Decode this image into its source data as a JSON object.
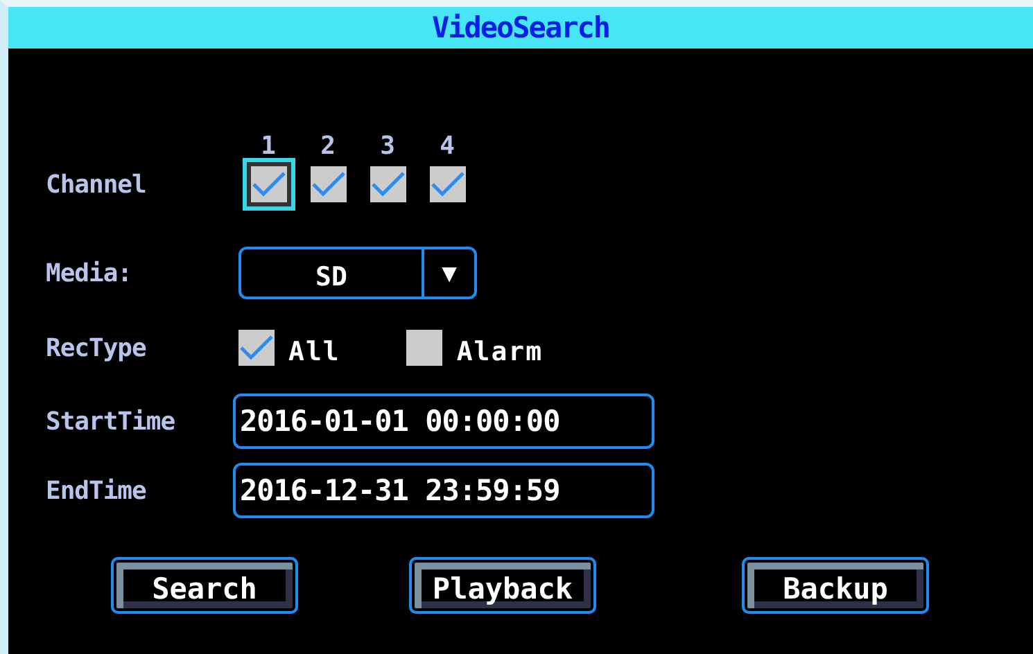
{
  "window": {
    "title": "VideoSearch"
  },
  "channel": {
    "label": "Channel",
    "items": [
      {
        "number": "1",
        "checked": true,
        "focused": true
      },
      {
        "number": "2",
        "checked": true,
        "focused": false
      },
      {
        "number": "3",
        "checked": true,
        "focused": false
      },
      {
        "number": "4",
        "checked": true,
        "focused": false
      }
    ]
  },
  "media": {
    "label": "Media:",
    "value": "SD",
    "arrow": "▼"
  },
  "rec_type": {
    "label": "RecType",
    "options": [
      {
        "label": "All",
        "checked": true
      },
      {
        "label": "Alarm",
        "checked": false
      }
    ]
  },
  "start_time": {
    "label": "StartTime",
    "value": "2016-01-01 00:00:00"
  },
  "end_time": {
    "label": "EndTime",
    "value": "2016-12-31 23:59:59"
  },
  "buttons": [
    "Search",
    "Playback",
    "Backup"
  ]
}
